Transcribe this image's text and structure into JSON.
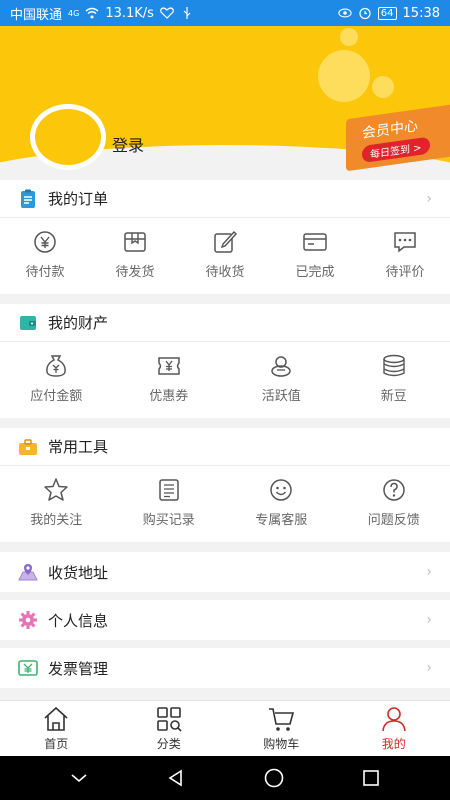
{
  "status_bar": {
    "carrier": "中国联通",
    "network": "4G",
    "speed": "13.1K/s",
    "battery": "64",
    "time": "15:38"
  },
  "header": {
    "login": "登录",
    "vip_title": "会员中心",
    "vip_sign": "每日签到 >"
  },
  "orders": {
    "title": "我的订单",
    "items": [
      {
        "label": "待付款",
        "icon": "yen-cycle-icon"
      },
      {
        "label": "待发货",
        "icon": "box-icon"
      },
      {
        "label": "待收货",
        "icon": "edit-icon"
      },
      {
        "label": "已完成",
        "icon": "card-icon"
      },
      {
        "label": "待评价",
        "icon": "comment-icon"
      }
    ]
  },
  "wealth": {
    "title": "我的财产",
    "items": [
      {
        "label": "应付金额",
        "icon": "money-bag-icon"
      },
      {
        "label": "优惠券",
        "icon": "coupon-icon"
      },
      {
        "label": "活跃值",
        "icon": "gift-icon"
      },
      {
        "label": "新豆",
        "icon": "coins-stack-icon"
      }
    ]
  },
  "tools": {
    "title": "常用工具",
    "items": [
      {
        "label": "我的关注",
        "icon": "star-icon"
      },
      {
        "label": "购买记录",
        "icon": "receipt-icon"
      },
      {
        "label": "专属客服",
        "icon": "smile-icon"
      },
      {
        "label": "问题反馈",
        "icon": "question-icon"
      }
    ]
  },
  "rows": [
    {
      "label": "收货地址",
      "icon": "map-pin-icon"
    },
    {
      "label": "个人信息",
      "icon": "gear-icon"
    },
    {
      "label": "发票管理",
      "icon": "invoice-icon"
    }
  ],
  "tabs": [
    {
      "label": "首页",
      "icon": "home-icon"
    },
    {
      "label": "分类",
      "icon": "category-icon"
    },
    {
      "label": "购物车",
      "icon": "cart-icon"
    },
    {
      "label": "我的",
      "icon": "person-icon"
    }
  ],
  "colors": {
    "header_yellow": "#fcc60a",
    "status_blue": "#1e8ae6",
    "active_red": "#d42a2a",
    "vip_orange": "#f08a2a"
  }
}
